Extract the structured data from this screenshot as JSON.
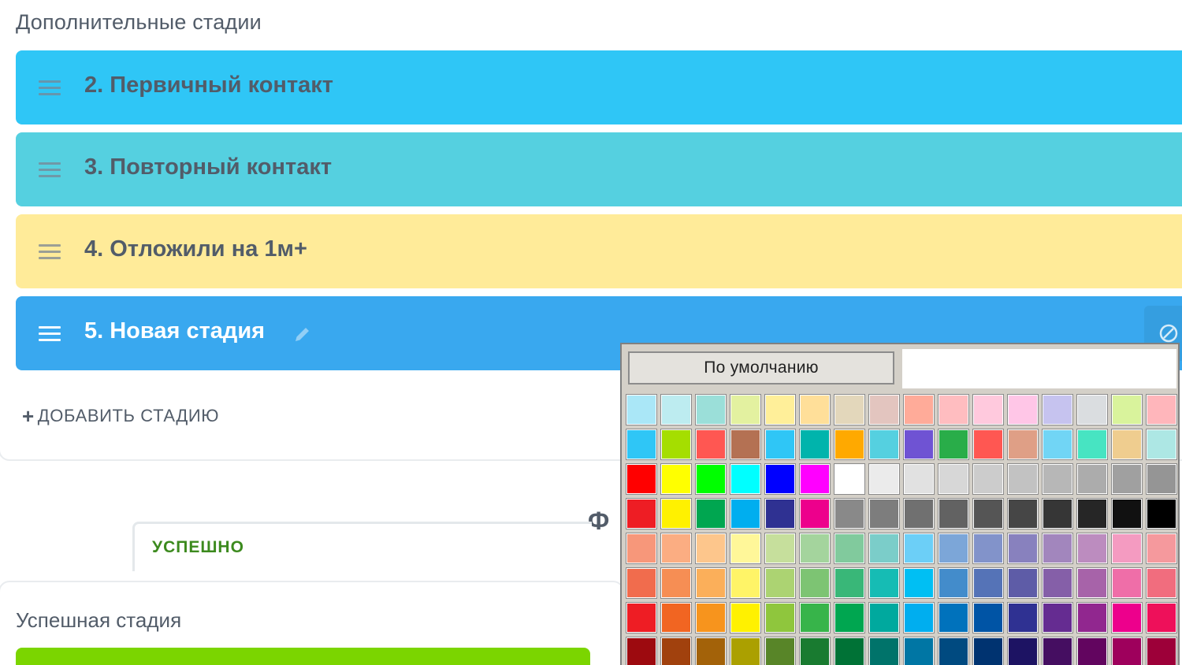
{
  "section": {
    "title": "Дополнительные стадии",
    "add_stage_plus": "+",
    "add_stage_label": "ДОБАВИТЬ СТАДИЮ"
  },
  "stages": [
    {
      "title": "2. Первичный контакт",
      "color": "#2fc6f6"
    },
    {
      "title": "3. Повторный контакт",
      "color": "#55d0e0"
    },
    {
      "title": "4. Отложили на 1м+",
      "color": "#ffeb99"
    },
    {
      "title": "5. Новая стадия",
      "color": "#39a8ef"
    }
  ],
  "icons": {
    "drag": "drag-handle-icon",
    "edit": "pencil-icon",
    "color": "color-picker-icon"
  },
  "final": {
    "title_fragment": "Ф",
    "tab_label": "УСПЕШНО",
    "success_stage_label": "Успешная стадия",
    "success_color": "#7bd500"
  },
  "palette": {
    "default_label": "По умолчанию",
    "rows": [
      [
        "#aae7f7",
        "#bdecf0",
        "#9bdfd9",
        "#e3f1a0",
        "#ffef99",
        "#ffdf99",
        "#e3d7bb",
        "#e3c5bf",
        "#ffab99",
        "#ffbdc0",
        "#ffc9dd",
        "#ffc6e7",
        "#c6c3ef",
        "#dadde0",
        "#d9f39c",
        "#ffb6bb"
      ],
      [
        "#2fc6f6",
        "#a5de00",
        "#ff5752",
        "#b47153",
        "#2fc6f6",
        "#00b4ac",
        "#ffa900",
        "#55d0e0",
        "#6f53d3",
        "#29ad49",
        "#ff5752",
        "#df9f86",
        "#71d5f5",
        "#47e4c2",
        "#efcd8f",
        "#ade7e4"
      ],
      [
        "#ff0000",
        "#ffff00",
        "#00ff00",
        "#00ffff",
        "#0000ff",
        "#ff00ff",
        "#ffffff",
        "#ebebeb",
        "#e1e1e1",
        "#d7d7d7",
        "#cccccc",
        "#c2c2c2",
        "#b7b7b7",
        "#acacac",
        "#a0a0a0",
        "#959595"
      ],
      [
        "#ee1d24",
        "#fff100",
        "#00a650",
        "#00aeef",
        "#2f3192",
        "#ed008c",
        "#898989",
        "#7d7d7d",
        "#707070",
        "#626262",
        "#555555",
        "#464646",
        "#363636",
        "#262626",
        "#111111",
        "#000000"
      ],
      [
        "#f7977a",
        "#fbad82",
        "#fdc68c",
        "#fff799",
        "#c6df9c",
        "#a4d49d",
        "#81ca9d",
        "#7bcdc9",
        "#6ccff7",
        "#7ca6d8",
        "#8293ca",
        "#8881be",
        "#a286bd",
        "#bc8cbf",
        "#f49bc1",
        "#f5999d"
      ],
      [
        "#f16c4d",
        "#f68e54",
        "#fbaf5a",
        "#fff467",
        "#acd372",
        "#7dc473",
        "#39b778",
        "#16bcb4",
        "#00bff3",
        "#438ccb",
        "#5573b7",
        "#5e5ca7",
        "#855fa8",
        "#a763a9",
        "#ef6ea8",
        "#f16d7e"
      ],
      [
        "#ee1d24",
        "#f16522",
        "#f7941d",
        "#fff100",
        "#8fc63d",
        "#37b44a",
        "#00a650",
        "#00a99e",
        "#00aeef",
        "#0072bc",
        "#0054a5",
        "#2f3192",
        "#652c91",
        "#91278f",
        "#ed008c",
        "#ee105a"
      ],
      [
        "#9d0a0f",
        "#a1410d",
        "#a36209",
        "#aba000",
        "#588528",
        "#197b30",
        "#007236",
        "#00736a",
        "#0076a4",
        "#004a80",
        "#003370",
        "#1d1363",
        "#450e61",
        "#62055f",
        "#9e005c",
        "#9d0039"
      ]
    ]
  }
}
